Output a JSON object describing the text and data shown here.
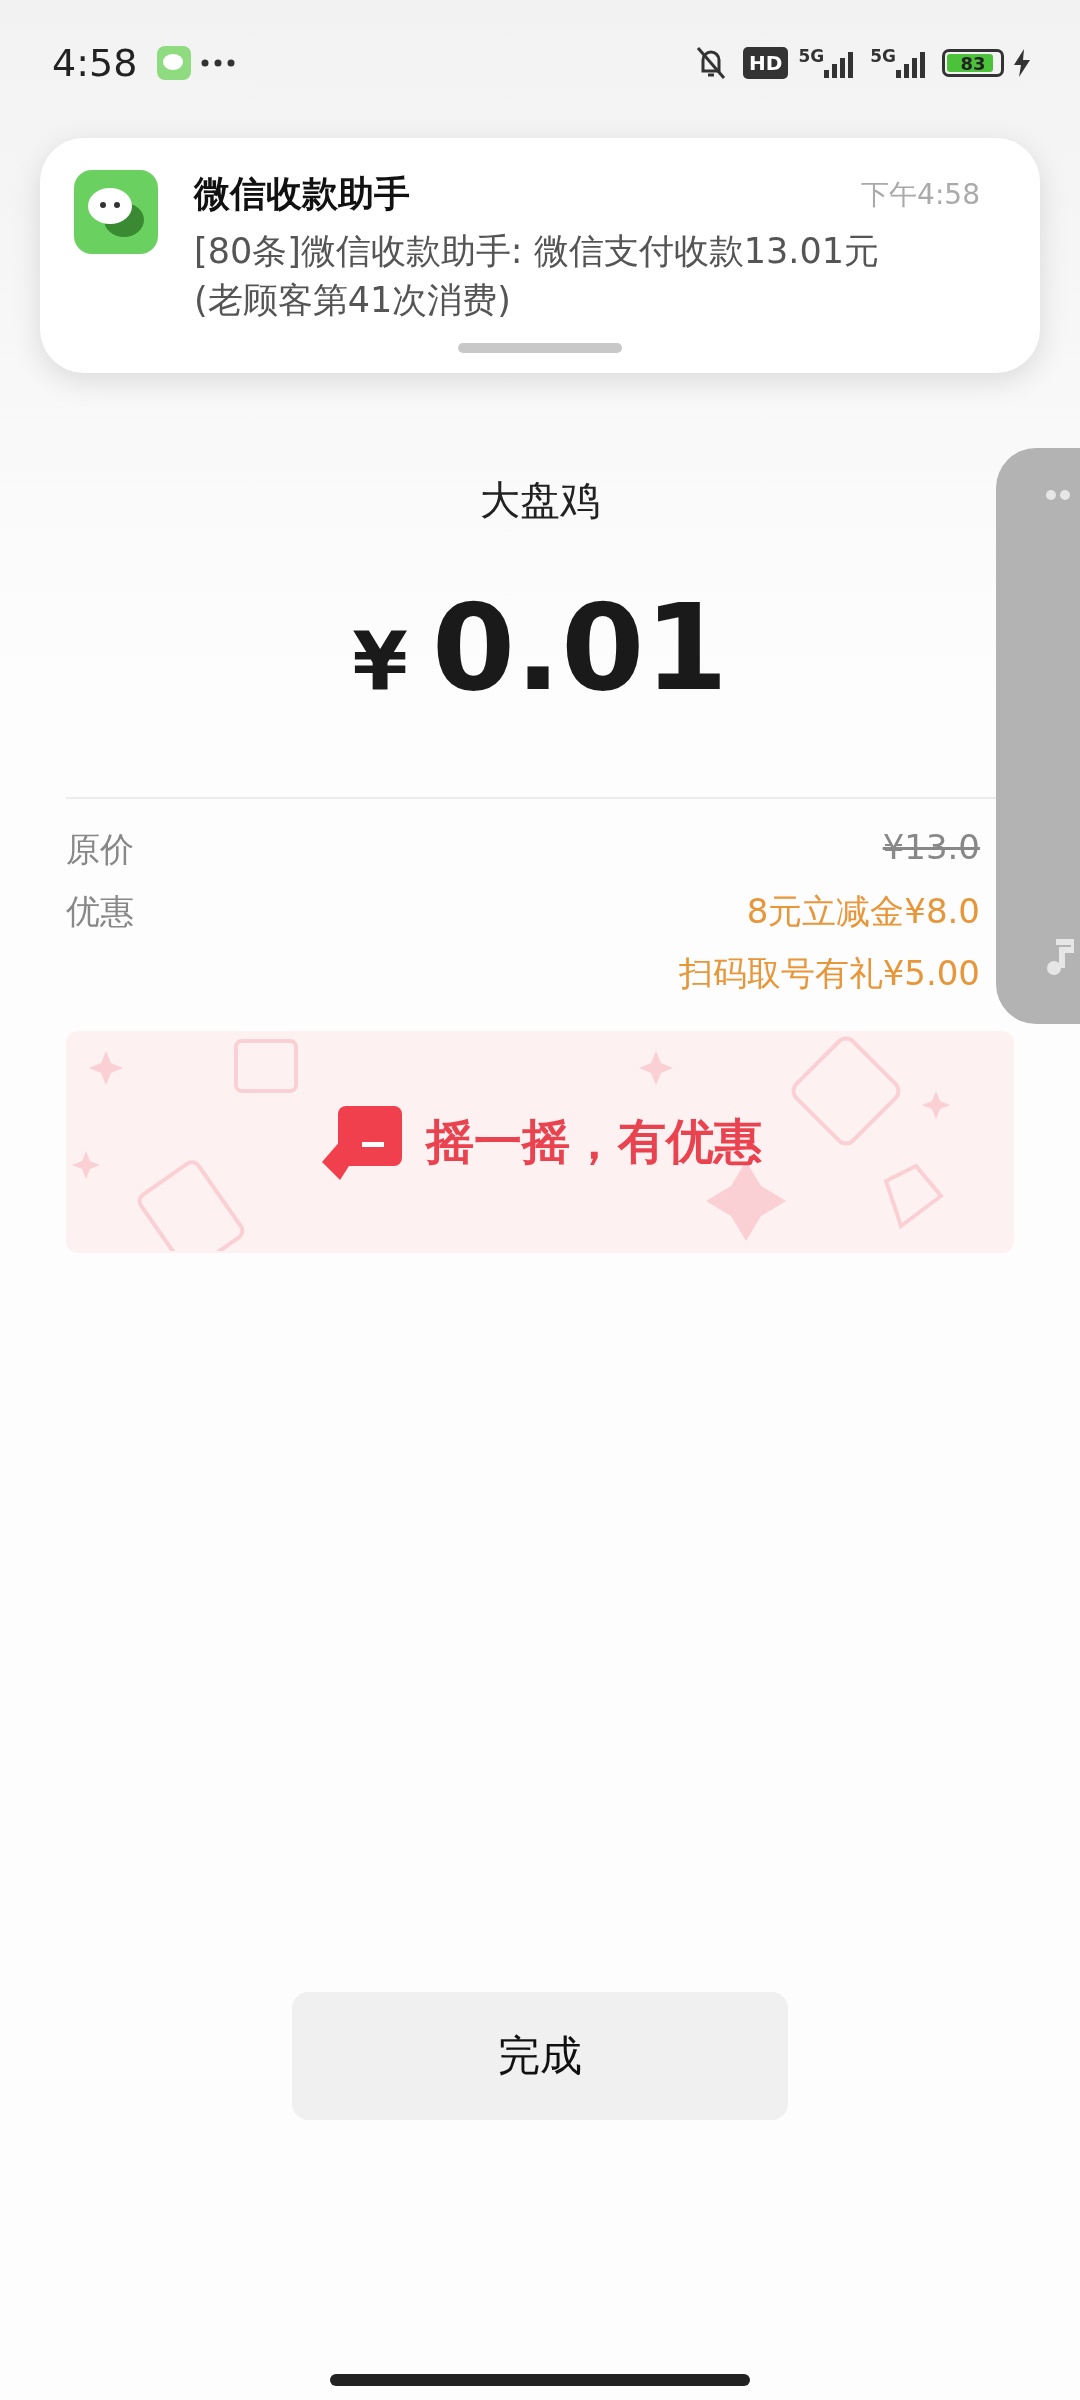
{
  "status_bar": {
    "time": "4:58",
    "hd": "HD",
    "network_1": "5G",
    "network_2": "5G",
    "battery": "83"
  },
  "notification": {
    "app": "微信收款助手",
    "time": "下午4:58",
    "message": "[80条]微信收款助手: 微信支付收款13.01元(老顾客第41次消费)"
  },
  "merchant": "大盘鸡",
  "amount": {
    "currency": "¥",
    "value": "0.01"
  },
  "original_price": {
    "label": "原价",
    "value": "¥13.0"
  },
  "discount": {
    "label": "优惠",
    "items": [
      "8元立减金¥8.0",
      "扫码取号有礼¥5.00"
    ]
  },
  "shake_banner": {
    "text": "摇一摇，有优惠"
  },
  "done_button": "完成"
}
